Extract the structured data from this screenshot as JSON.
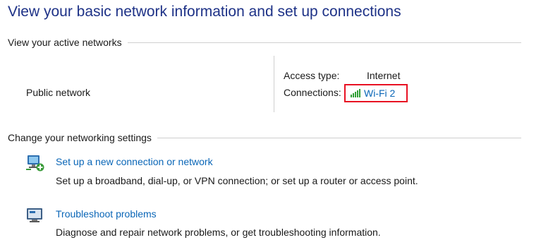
{
  "page": {
    "title": "View your basic network information and set up connections"
  },
  "active_networks": {
    "header": "View your active networks",
    "network_name": "Public network",
    "access_type_label": "Access type:",
    "access_type_value": "Internet",
    "connections_label": "Connections:",
    "connection_name": "Wi-Fi 2",
    "connection_icon": "wifi-signal-icon",
    "highlight_color": "#e81123",
    "signal_color": "#2f9e33"
  },
  "change_settings": {
    "header": "Change your networking settings",
    "tasks": [
      {
        "icon": "network-setup-icon",
        "link": "Set up a new connection or network",
        "description": "Set up a broadband, dial-up, or VPN connection; or set up a router or access point."
      },
      {
        "icon": "troubleshoot-icon",
        "link": "Troubleshoot problems",
        "description": "Diagnose and repair network problems, or get troubleshooting information."
      }
    ]
  },
  "colors": {
    "title": "#1e3287",
    "link": "#0a66b7"
  }
}
